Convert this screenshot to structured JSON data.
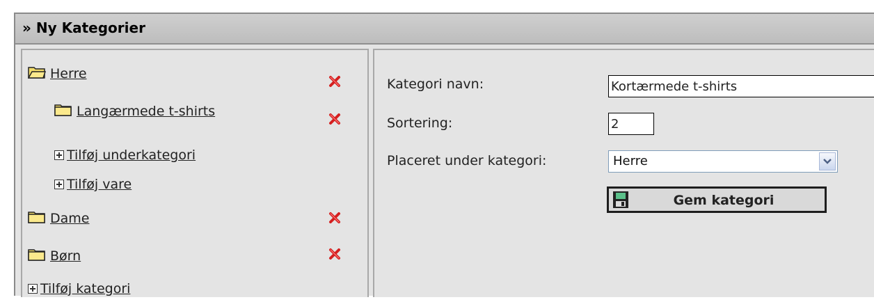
{
  "panel": {
    "title": "» Ny Kategorier"
  },
  "tree": {
    "items": [
      {
        "label": "Herre"
      },
      {
        "label": "Langærmede t-shirts"
      },
      {
        "label": "Tilføj underkategori"
      },
      {
        "label": "Tilføj vare"
      },
      {
        "label": "Dame"
      },
      {
        "label": "Børn"
      },
      {
        "label": "Tilføj kategori"
      }
    ]
  },
  "form": {
    "name_label": "Kategori navn:",
    "name_value": "Kortærmede t-shirts",
    "sort_label": "Sortering:",
    "sort_value": "2",
    "parent_label": "Placeret under kategori:",
    "parent_value": "Herre",
    "save_label": "Gem kategori"
  },
  "colors": {
    "delete_icon": "#d42020",
    "folder_icon": "#f2dc6a",
    "header_bg": "#c6c6c6",
    "panel_bg": "#e4e4e4"
  }
}
